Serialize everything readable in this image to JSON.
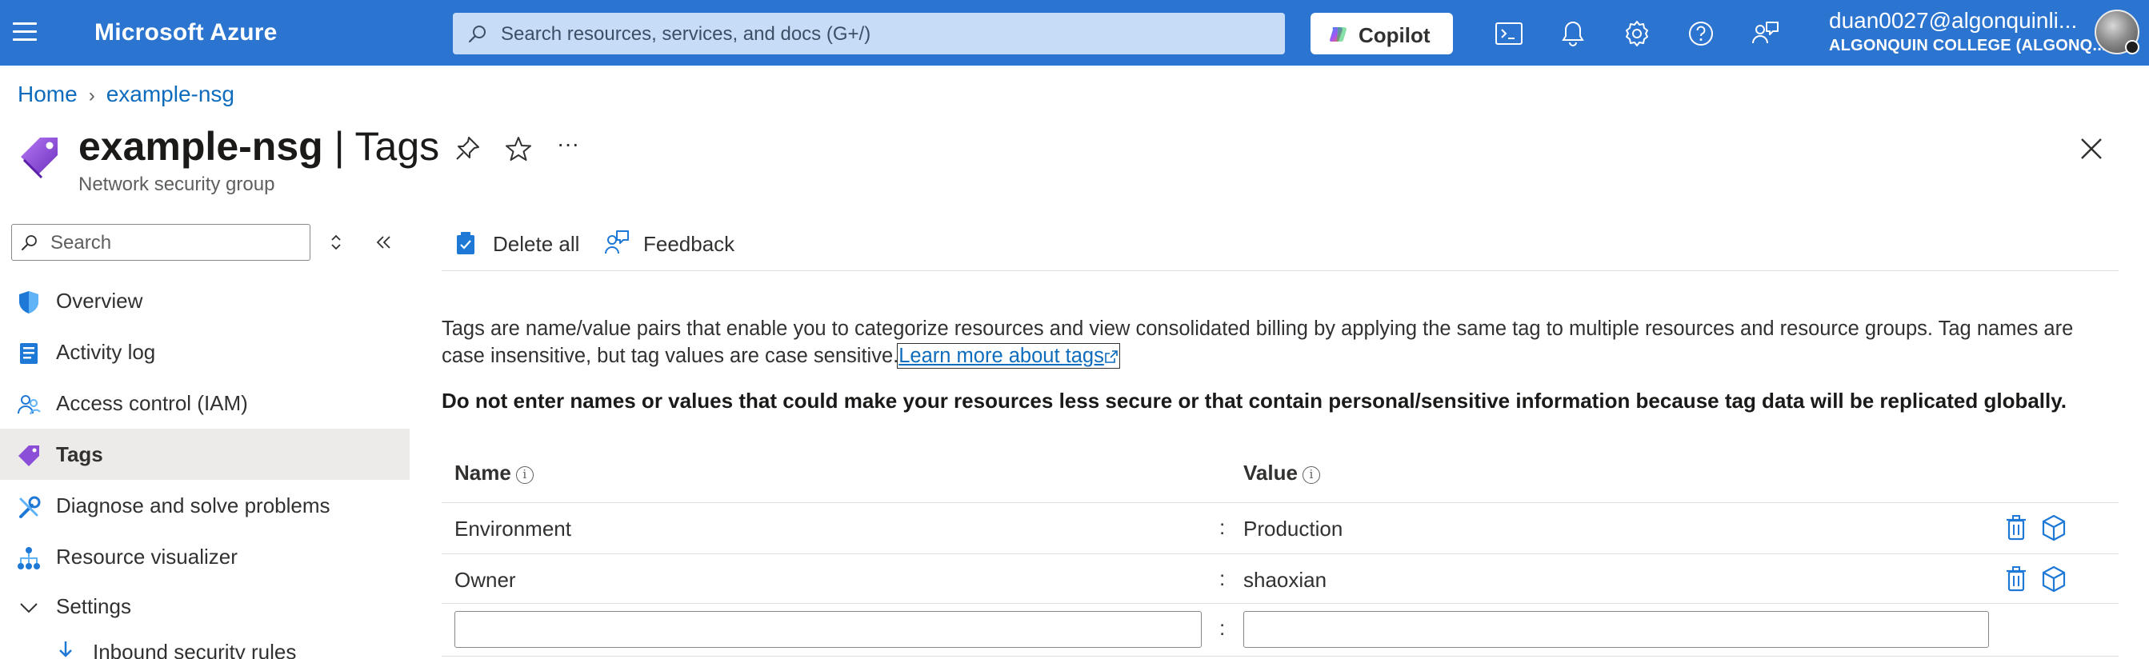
{
  "topbar": {
    "brand": "Microsoft Azure",
    "search_placeholder": "Search resources, services, and docs (G+/)",
    "copilot_label": "Copilot",
    "user_email": "duan0027@algonquinli...",
    "user_org": "ALGONQUIN COLLEGE (ALGONQ..."
  },
  "breadcrumb": {
    "home": "Home",
    "current": "example-nsg"
  },
  "page": {
    "resource_name": "example-nsg",
    "separator": " | ",
    "blade_name": "Tags",
    "subtitle": "Network security group",
    "more_label": "···"
  },
  "sidebar": {
    "search_placeholder": "Search",
    "items": [
      {
        "label": "Overview",
        "icon": "shield-icon"
      },
      {
        "label": "Activity log",
        "icon": "log-icon"
      },
      {
        "label": "Access control (IAM)",
        "icon": "people-icon"
      },
      {
        "label": "Tags",
        "icon": "tag-icon",
        "active": true
      },
      {
        "label": "Diagnose and solve problems",
        "icon": "wrench-icon"
      },
      {
        "label": "Resource visualizer",
        "icon": "hierarchy-icon"
      },
      {
        "label": "Settings",
        "icon": "chevron-down-icon",
        "expanded": true
      },
      {
        "label": "Inbound security rules",
        "icon": "arrow-down-icon"
      }
    ]
  },
  "toolbar": {
    "delete_all": "Delete all",
    "feedback": "Feedback"
  },
  "content": {
    "description": "Tags are name/value pairs that enable you to categorize resources and view consolidated billing by applying the same tag to multiple resources and resource groups. Tag names are case insensitive, but tag values are case sensitive.",
    "learn_more": "Learn more about tags",
    "warning": "Do not enter names or values that could make your resources less secure or that contain personal/sensitive information because tag data will be replicated globally."
  },
  "tags_table": {
    "name_header": "Name",
    "value_header": "Value",
    "separator": ":",
    "info_glyph": "i",
    "rows": [
      {
        "name": "Environment",
        "value": "Production"
      },
      {
        "name": "Owner",
        "value": "shaoxian"
      }
    ],
    "new_row": {
      "name": "",
      "value": ""
    }
  },
  "colors": {
    "topbar_bg": "#2b74d0",
    "link": "#0f6cbd",
    "active_nav_bg": "#edebe9"
  }
}
